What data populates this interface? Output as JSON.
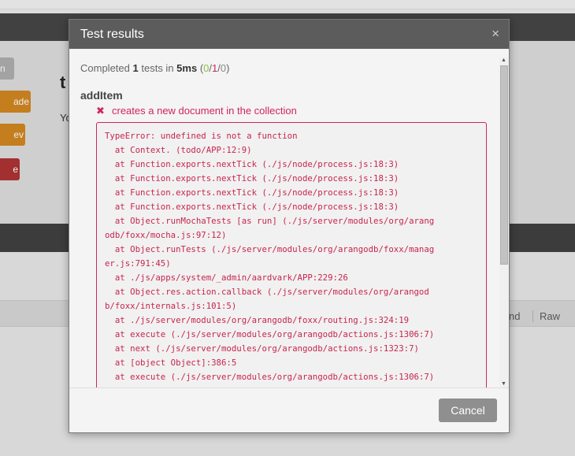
{
  "background": {
    "buttons": [
      "n",
      "ade",
      "ev",
      "e"
    ],
    "title": "t",
    "text": "Yo",
    "tabs": {
      "expand": "nd",
      "raw": "Raw"
    }
  },
  "modal": {
    "title": "Test results",
    "close_icon": "×",
    "summary": {
      "prefix": "Completed",
      "count": "1",
      "tests_in": "tests in",
      "duration": "5ms",
      "open_paren": "(",
      "passed": "0",
      "sep1": "/",
      "failed": "1",
      "sep2": "/",
      "pending": "0",
      "close_paren": ")"
    },
    "suite": {
      "name": "addItem",
      "test": {
        "status_icon": "✖",
        "title": "creates a new document in the collection",
        "error_lines": [
          "TypeError: undefined is not a function",
          "  at Context. (todo/APP:12:9)",
          "  at Function.exports.nextTick (./js/node/process.js:18:3)",
          "  at Function.exports.nextTick (./js/node/process.js:18:3)",
          "  at Function.exports.nextTick (./js/node/process.js:18:3)",
          "  at Function.exports.nextTick (./js/node/process.js:18:3)",
          "  at Object.runMochaTests [as run] (./js/server/modules/org/arang",
          "odb/foxx/mocha.js:97:12)",
          "  at Object.runTests (./js/server/modules/org/arangodb/foxx/manag",
          "er.js:791:45)",
          "  at ./js/apps/system/_admin/aardvark/APP:229:26",
          "  at Object.res.action.callback (./js/server/modules/org/arangod",
          "b/foxx/internals.js:101:5)",
          "  at ./js/server/modules/org/arangodb/foxx/routing.js:324:19",
          "  at execute (./js/server/modules/org/arangodb/actions.js:1306:7)",
          "  at next (./js/server/modules/org/arangodb/actions.js:1323:7)",
          "  at [object Object]:386:5",
          "  at execute (./js/server/modules/org/arangodb/actions.js:1306:7)"
        ]
      }
    },
    "footer": {
      "cancel_label": "Cancel"
    },
    "colors": {
      "pass": "#8cbf3f",
      "fail": "#d0245f",
      "header": "#5c5c5c",
      "cancel": "#8f8f8f"
    }
  }
}
